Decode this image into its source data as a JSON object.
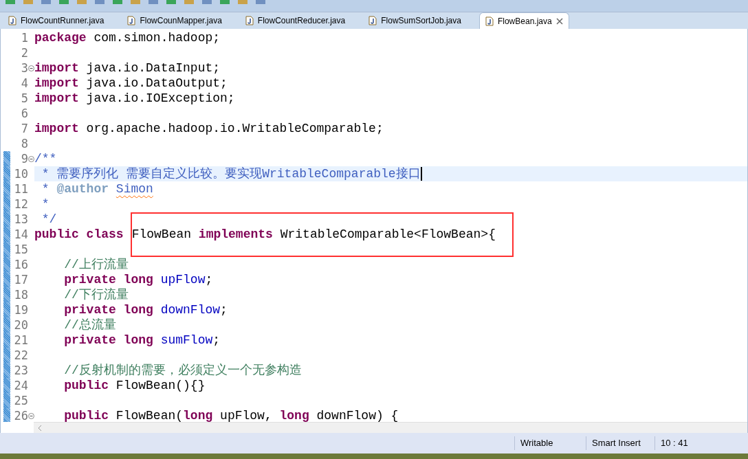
{
  "tabs": [
    {
      "label": "FlowCountRunner.java",
      "selected": false
    },
    {
      "label": "FlowCounMapper.java",
      "selected": false
    },
    {
      "label": "FlowCountReducer.java",
      "selected": false
    },
    {
      "label": "FlowSumSortJob.java",
      "selected": false
    },
    {
      "label": "FlowBean.java",
      "selected": true
    }
  ],
  "lines": [
    {
      "number": "1",
      "fold": false,
      "changed": false,
      "current": false,
      "tokens": [
        {
          "kind": "kw",
          "text": "package"
        },
        {
          "kind": "plain",
          "text": " com.simon.hadoop;"
        }
      ]
    },
    {
      "number": "2",
      "fold": false,
      "changed": false,
      "current": false
    },
    {
      "number": "3",
      "fold": true,
      "changed": false,
      "current": false,
      "tokens": [
        {
          "kind": "kw",
          "text": "import"
        },
        {
          "kind": "plain",
          "text": " java.io.DataInput;"
        }
      ]
    },
    {
      "number": "4",
      "fold": false,
      "changed": false,
      "current": false,
      "tokens": [
        {
          "kind": "kw",
          "text": "import"
        },
        {
          "kind": "plain",
          "text": " java.io.DataOutput;"
        }
      ]
    },
    {
      "number": "5",
      "fold": false,
      "changed": false,
      "current": false,
      "tokens": [
        {
          "kind": "kw",
          "text": "import"
        },
        {
          "kind": "plain",
          "text": " java.io.IOException;"
        }
      ]
    },
    {
      "number": "6",
      "fold": false,
      "changed": false,
      "current": false
    },
    {
      "number": "7",
      "fold": false,
      "changed": false,
      "current": false,
      "tokens": [
        {
          "kind": "kw",
          "text": "import"
        },
        {
          "kind": "plain",
          "text": " org.apache.hadoop.io.WritableComparable;"
        }
      ]
    },
    {
      "number": "8",
      "fold": false,
      "changed": false,
      "current": false
    },
    {
      "number": "9",
      "fold": true,
      "changed": true,
      "current": false,
      "tokens": [
        {
          "kind": "doc",
          "text": "/**"
        }
      ]
    },
    {
      "number": "10",
      "fold": false,
      "changed": true,
      "current": true,
      "tokens": [
        {
          "kind": "doc",
          "text": " * 需要序列化 需要自定义比较。要实现WritableComparable接口"
        }
      ]
    },
    {
      "number": "11",
      "fold": false,
      "changed": true,
      "current": false,
      "tokens": [
        {
          "kind": "doc",
          "text": " *"
        },
        {
          "kind": "doctag",
          "text": " @author "
        },
        {
          "kind": "doc",
          "text": "Simon",
          "misspelled": true
        }
      ]
    },
    {
      "number": "12",
      "fold": false,
      "changed": true,
      "current": false,
      "tokens": [
        {
          "kind": "doc",
          "text": " *"
        }
      ]
    },
    {
      "number": "13",
      "fold": false,
      "changed": true,
      "current": false,
      "tokens": [
        {
          "kind": "doc",
          "text": " */"
        }
      ]
    },
    {
      "number": "14",
      "fold": false,
      "changed": true,
      "current": false,
      "tokens": [
        {
          "kind": "kw",
          "text": "public"
        },
        {
          "kind": "kw",
          "text": " class"
        },
        {
          "kind": "plain",
          "text": "FlowBean",
          "boxed": true
        },
        {
          "kind": "kw",
          "text": " implements",
          "boxed": true
        },
        {
          "kind": "plain",
          "text": " WritableComparable<FlowBean>{",
          "boxed": true
        }
      ]
    },
    {
      "number": "15",
      "fold": false,
      "changed": true,
      "current": false
    },
    {
      "number": "16",
      "fold": false,
      "changed": true,
      "current": false,
      "tokens": [
        {
          "kind": "comment",
          "text": "    //上行流量"
        }
      ]
    },
    {
      "number": "17",
      "fold": false,
      "changed": true,
      "current": false,
      "tokens": [
        {
          "kind": "kw",
          "text": "    private long"
        },
        {
          "kind": "field",
          "text": " upFlow"
        },
        {
          "kind": "plain",
          "text": ";"
        }
      ]
    },
    {
      "number": "18",
      "fold": false,
      "changed": true,
      "current": false,
      "tokens": [
        {
          "kind": "comment",
          "text": "    //下行流量"
        }
      ]
    },
    {
      "number": "19",
      "fold": false,
      "changed": true,
      "current": false,
      "tokens": [
        {
          "kind": "kw",
          "text": "    private long"
        },
        {
          "kind": "field",
          "text": " downFlow"
        },
        {
          "kind": "plain",
          "text": ";"
        }
      ]
    },
    {
      "number": "20",
      "fold": false,
      "changed": true,
      "current": false,
      "tokens": [
        {
          "kind": "comment",
          "text": "    //总流量"
        }
      ]
    },
    {
      "number": "21",
      "fold": false,
      "changed": true,
      "current": false,
      "tokens": [
        {
          "kind": "kw",
          "text": "    private long"
        },
        {
          "kind": "field",
          "text": " sumFlow"
        },
        {
          "kind": "plain",
          "text": ";"
        }
      ]
    },
    {
      "number": "22",
      "fold": false,
      "changed": true,
      "current": false
    },
    {
      "number": "23",
      "fold": false,
      "changed": true,
      "current": false,
      "tokens": [
        {
          "kind": "comment",
          "text": "    //反射机制的需要，必须定义一个无参构造"
        }
      ]
    },
    {
      "number": "24",
      "fold": false,
      "changed": true,
      "current": false,
      "tokens": [
        {
          "kind": "kw",
          "text": "    public"
        },
        {
          "kind": "plain",
          "text": " FlowBean(){}"
        }
      ]
    },
    {
      "number": "25",
      "fold": false,
      "changed": true,
      "current": false
    },
    {
      "number": "26",
      "fold": true,
      "changed": true,
      "current": false,
      "tokens": [
        {
          "kind": "kw",
          "text": "    public"
        },
        {
          "kind": "plain",
          "text": " FlowBean("
        },
        {
          "kind": "kw",
          "text": "long"
        },
        {
          "kind": "plain",
          "text": " upFlow, "
        },
        {
          "kind": "kw",
          "text": "long"
        },
        {
          "kind": "plain",
          "text": " downFlow) {"
        }
      ]
    }
  ],
  "status_bar": {
    "write_mode": "Writable",
    "insert_mode": "Smart Insert",
    "position": "10 : 41"
  }
}
